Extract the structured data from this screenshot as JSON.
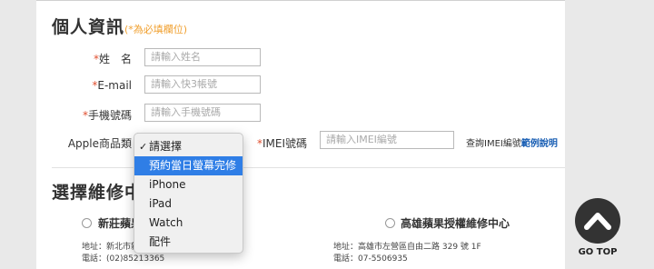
{
  "personal": {
    "title": "個人資訊",
    "required_note": "(*為必填欄位)",
    "name": {
      "label": "姓　名",
      "placeholder": "請輸入姓名"
    },
    "email": {
      "label": "E-mail",
      "placeholder": "請輸入快3帳號"
    },
    "phone": {
      "label": "手機號碼",
      "placeholder": "請輸入手機號碼"
    },
    "product": {
      "label": "Apple商品類"
    },
    "imei": {
      "label": "IMEI號碼",
      "placeholder": "請輸入IMEI編號",
      "help_prefix": "查詢IMEI編號",
      "help_link": "範例說明"
    },
    "required_mark": "*"
  },
  "dropdown": {
    "options": [
      {
        "label": "請選擇",
        "checked": true
      },
      {
        "label": "預約當日螢幕完修",
        "highlighted": true
      },
      {
        "label": "iPhone"
      },
      {
        "label": "iPad"
      },
      {
        "label": "Watch"
      },
      {
        "label": "配件"
      }
    ],
    "check_glyph": "✓"
  },
  "repair": {
    "title": "選擇維修中",
    "centers": [
      {
        "name": "新莊蘋果",
        "address": "地址：新北市新",
        "phone": "電話：(02)85213365"
      },
      {
        "name": "高雄蘋果授權維修中心",
        "address": "地址：高雄市左營區自由二路 329 號 1F",
        "phone": "電話：07-5506935"
      }
    ]
  },
  "go_top": {
    "label": "GO TOP"
  },
  "colors": {
    "required_star": "#e05030",
    "note": "#f0a030",
    "link": "#1a5fb4",
    "highlight": "#2f7ee6"
  }
}
